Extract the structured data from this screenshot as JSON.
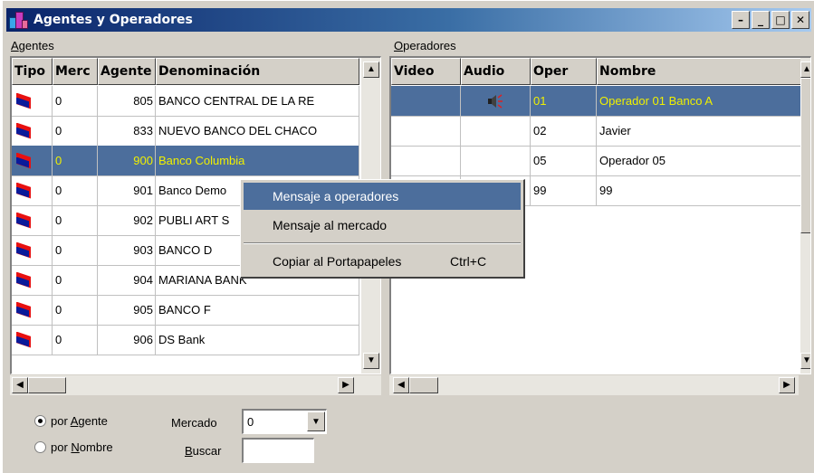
{
  "window": {
    "title": "Agentes y Operadores"
  },
  "titlebar_buttons": [
    "–",
    "_",
    "□",
    "✕"
  ],
  "agentes": {
    "label_first": "A",
    "label_rest": "gentes",
    "columns": [
      "Tipo",
      "Merc",
      "Agente",
      "Denominación"
    ],
    "rows": [
      {
        "merc": "0",
        "agente": "805",
        "denominacion": "BANCO CENTRAL DE LA RE"
      },
      {
        "merc": "0",
        "agente": "833",
        "denominacion": "NUEVO BANCO DEL CHACO"
      },
      {
        "merc": "0",
        "agente": "900",
        "denominacion": "Banco Columbia",
        "selected": true
      },
      {
        "merc": "0",
        "agente": "901",
        "denominacion": "Banco Demo"
      },
      {
        "merc": "0",
        "agente": "902",
        "denominacion": "PUBLI ART S"
      },
      {
        "merc": "0",
        "agente": "903",
        "denominacion": "BANCO D"
      },
      {
        "merc": "0",
        "agente": "904",
        "denominacion": "MARIANA BANK"
      },
      {
        "merc": "0",
        "agente": "905",
        "denominacion": "BANCO F"
      },
      {
        "merc": "0",
        "agente": "906",
        "denominacion": "DS Bank"
      }
    ]
  },
  "operadores": {
    "label_first": "O",
    "label_rest": "peradores",
    "columns": [
      "Video",
      "Audio",
      "Oper",
      "Nombre"
    ],
    "rows": [
      {
        "video": "",
        "audio_icon": "speaker-icon",
        "oper": "01",
        "nombre": "Operador 01 Banco A",
        "selected": true
      },
      {
        "video": "",
        "audio_icon": "",
        "oper": "02",
        "nombre": "Javier"
      },
      {
        "video": "",
        "audio_icon": "",
        "oper": "05",
        "nombre": "Operador 05"
      },
      {
        "video": "",
        "audio_icon": "",
        "oper": "99",
        "nombre": "99"
      }
    ]
  },
  "context_menu": {
    "items": [
      {
        "label": "Mensaje a operadores",
        "shortcut": "",
        "highlighted": true
      },
      {
        "label": "Mensaje al mercado",
        "shortcut": ""
      },
      {
        "label": "Copiar al Portapapeles",
        "shortcut": "Ctrl+C"
      }
    ]
  },
  "footer": {
    "radio_agente": {
      "prefix": "por ",
      "key": "A",
      "rest": "gente",
      "checked": true
    },
    "radio_nombre": {
      "prefix": "por ",
      "key": "N",
      "rest": "ombre",
      "checked": false
    },
    "mercado_label": "Mercado",
    "mercado_value": "0",
    "buscar_key": "B",
    "buscar_rest": "uscar",
    "buscar_value": ""
  },
  "colors": {
    "selection": "#4c6e9c",
    "selection_text": "#f0f000",
    "title_start": "#0a246a"
  }
}
